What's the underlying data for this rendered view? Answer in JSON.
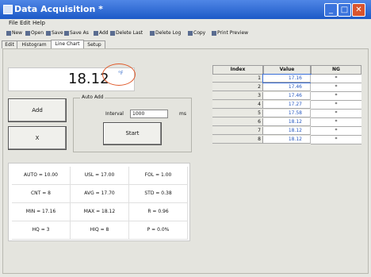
{
  "window": {
    "title": "Data Acquisition *"
  },
  "window_buttons": {
    "minimize": "_",
    "maximize": "□",
    "close": "✕"
  },
  "menu": [
    "File",
    "Edit",
    "Help"
  ],
  "toolbar": [
    "New",
    "Open",
    "Save",
    "Save As",
    "Add",
    "Delete Last",
    "Delete Log",
    "Copy",
    "Print Preview"
  ],
  "tabs": [
    "Edit",
    "Histogram",
    "Line Chart",
    "Setup"
  ],
  "reading": {
    "value": "18.12",
    "unit": "°F"
  },
  "buttons": {
    "add": "Add",
    "delete": "X",
    "start": "Start"
  },
  "auto_add": {
    "label": "Auto Add",
    "interval_label": "Interval",
    "interval_value": "1000",
    "unit": "ms"
  },
  "stats": [
    [
      "AUTO = 10.00",
      "USL = 17.00",
      "FOL = 1.00"
    ],
    [
      "CNT = 8",
      "AVG = 17.70",
      "STD = 0.38"
    ],
    [
      "MIN = 17.16",
      "MAX = 18.12",
      "R = 0.96"
    ],
    [
      "HQ = 3",
      "HIQ = 8",
      "P = 0.0%"
    ]
  ],
  "table": {
    "headers": [
      "Index",
      "Value",
      "NG"
    ],
    "rows": [
      [
        "1",
        "17.16",
        "*"
      ],
      [
        "2",
        "17.46",
        "*"
      ],
      [
        "3",
        "17.46",
        "*"
      ],
      [
        "4",
        "17.27",
        "*"
      ],
      [
        "5",
        "17.58",
        "*"
      ],
      [
        "6",
        "18.12",
        "*"
      ],
      [
        "7",
        "18.12",
        "*"
      ],
      [
        "8",
        "18.12",
        "*"
      ]
    ]
  }
}
